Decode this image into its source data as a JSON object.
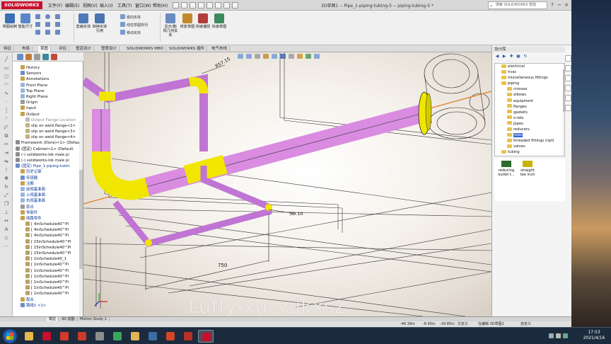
{
  "app": {
    "logo": "SOLIDWORKS",
    "title": "3D草图1 -- Pipe_1-piping-tubing-5 -- piping-tubing-5 *",
    "menu": [
      "文件(F)",
      "编辑(E)",
      "视图(V)",
      "插入(I)",
      "工具(T)",
      "窗口(W)",
      "帮助(H)"
    ],
    "search_placeholder": "搜索 SOLIDWORKS 帮助",
    "window_controls": [
      "?",
      "−",
      "□",
      "×"
    ]
  },
  "ribbon": {
    "big_buttons": [
      {
        "label": "草图绘制",
        "icon": "sketch-icon",
        "color": "#3a6fb5"
      },
      {
        "label": "智能尺寸",
        "icon": "smart-dimension-icon",
        "color": "#5a86c8"
      },
      {
        "label": "剪裁实体",
        "icon": "trim-entities-icon",
        "color": "#4f7ab8"
      },
      {
        "label": "转换实体引用",
        "icon": "convert-entities-icon",
        "color": "#4b74b0"
      },
      {
        "label": "显示/删除几何关系",
        "icon": "relations-icon",
        "color": "#6a8ac0"
      },
      {
        "label": "修复草图",
        "icon": "repair-sketch-icon",
        "color": "#c28a2a"
      },
      {
        "label": "快速捕捉",
        "icon": "quick-snaps-icon",
        "color": "#b13d3d"
      },
      {
        "label": "快速草图",
        "icon": "rapid-sketch-icon",
        "color": "#3d8a5a"
      }
    ],
    "small_buttons": [
      "镜向实体",
      "线性草图阵列",
      "移动实体"
    ]
  },
  "command_tabs": [
    "特征",
    "布局",
    "草图",
    "评估",
    "管道设计",
    "管筒设计",
    "SOLIDWORKS MBD",
    "SOLIDWORKS 插件",
    "电气布线"
  ],
  "feature_tree": [
    {
      "label": "History",
      "indent": 1,
      "color": "#c7a14a",
      "style": ""
    },
    {
      "label": "Sensors",
      "indent": 1,
      "color": "#6b8cc7",
      "style": ""
    },
    {
      "label": "Annotations",
      "indent": 1,
      "color": "#c7a14a",
      "style": ""
    },
    {
      "label": "Front Plane",
      "indent": 1,
      "color": "#9bb5dc",
      "style": ""
    },
    {
      "label": "Top Plane",
      "indent": 1,
      "color": "#9bb5dc",
      "style": ""
    },
    {
      "label": "Right Plane",
      "indent": 1,
      "color": "#9bb5dc",
      "style": ""
    },
    {
      "label": "Origin",
      "indent": 1,
      "color": "#999999",
      "style": ""
    },
    {
      "label": "Input",
      "indent": 1,
      "color": "#c7a14a",
      "style": ""
    },
    {
      "label": "Output",
      "indent": 1,
      "color": "#c7a14a",
      "style": ""
    },
    {
      "label": "Output Flange Location",
      "indent": 2,
      "color": "#bbbbbb",
      "style": "gray"
    },
    {
      "label": "slip on weld flange<2>",
      "indent": 2,
      "color": "#c2b280",
      "style": ""
    },
    {
      "label": "slip on weld flange<3>",
      "indent": 2,
      "color": "#c2b280",
      "style": ""
    },
    {
      "label": "slip on weld flange<4>",
      "indent": 2,
      "color": "#c2b280",
      "style": ""
    },
    {
      "label": "Framework (Done)<1> (Defau",
      "indent": 0,
      "color": "#8c8c8c",
      "style": ""
    },
    {
      "label": "(固定) Cabinet<1> (Default",
      "indent": 0,
      "color": "#8c8c8c",
      "style": ""
    },
    {
      "label": "(-) solidworks-lok male pi",
      "indent": 0,
      "color": "#8c8c8c",
      "style": ""
    },
    {
      "label": "(-) solidworks-lok male pi",
      "indent": 0,
      "color": "#8c8c8c",
      "style": ""
    },
    {
      "label": "(固定) Pipe_1-piping-tubin",
      "indent": 0,
      "color": "#6b8cc7",
      "style": "blue"
    },
    {
      "label": "历史记录",
      "indent": 1,
      "color": "#c7a14a",
      "style": "blue"
    },
    {
      "label": "传感器",
      "indent": 1,
      "color": "#6b8cc7",
      "style": "blue"
    },
    {
      "label": "注解",
      "indent": 1,
      "color": "#c7a14a",
      "style": "blue"
    },
    {
      "label": "前视基准面",
      "indent": 1,
      "color": "#9bb5dc",
      "style": "blue"
    },
    {
      "label": "上视基准面",
      "indent": 1,
      "color": "#9bb5dc",
      "style": "blue"
    },
    {
      "label": "右视基准面",
      "indent": 1,
      "color": "#9bb5dc",
      "style": "blue"
    },
    {
      "label": "原点",
      "indent": 1,
      "color": "#999999",
      "style": "blue"
    },
    {
      "label": "零部件",
      "indent": 1,
      "color": "#c7a14a",
      "style": "blue"
    },
    {
      "label": "线路零件",
      "indent": 1,
      "color": "#c7a14a",
      "style": "blue"
    },
    {
      "label": "[ 4inSchedule40^Pi",
      "indent": 2,
      "color": "#b7a36a",
      "style": ""
    },
    {
      "label": "[ 4inSchedule40^Pi",
      "indent": 2,
      "color": "#b7a36a",
      "style": ""
    },
    {
      "label": "[ 4inSchedule40^Pi",
      "indent": 2,
      "color": "#b7a36a",
      "style": ""
    },
    {
      "label": "[ 15inSchedule40^Pi",
      "indent": 2,
      "color": "#b7a36a",
      "style": ""
    },
    {
      "label": "[ 15inSchedule40^Pi",
      "indent": 2,
      "color": "#b7a36a",
      "style": ""
    },
    {
      "label": "[ 15inSchedule40^Pi",
      "indent": 2,
      "color": "#b7a36a",
      "style": ""
    },
    {
      "label": "[ 1inSchedule40_1",
      "indent": 2,
      "color": "#b7a36a",
      "style": ""
    },
    {
      "label": "[ 1inSchedule40^Pi",
      "indent": 2,
      "color": "#b7a36a",
      "style": ""
    },
    {
      "label": "[ 1inSchedule40^Pi",
      "indent": 2,
      "color": "#b7a36a",
      "style": ""
    },
    {
      "label": "[ 1inSchedule40^Pi",
      "indent": 2,
      "color": "#b7a36a",
      "style": ""
    },
    {
      "label": "[ 1inSchedule40^Pi",
      "indent": 2,
      "color": "#b7a36a",
      "style": ""
    },
    {
      "label": "[ 1inSchedule40^Pi",
      "indent": 2,
      "color": "#b7a36a",
      "style": ""
    },
    {
      "label": "[ 1inSchedule40^Pi",
      "indent": 2,
      "color": "#b7a36a",
      "style": ""
    },
    {
      "label": "配合",
      "indent": 1,
      "color": "#c7a14a",
      "style": "blue"
    },
    {
      "label": "路线1 <1>",
      "indent": 1,
      "color": "#6b8cc7",
      "style": "blue"
    }
  ],
  "viewport": {
    "dimensions": [
      "R57.15",
      "750",
      "3D.10"
    ],
    "watermark": "Luffy-xu:szjkxsz",
    "pipe_color": "#d98ce0",
    "fitting_color": "#f0e600"
  },
  "task_pane": {
    "header": "设计库",
    "library_tree": [
      {
        "label": "electrical",
        "indent": 1,
        "selected": false
      },
      {
        "label": "hvac",
        "indent": 1,
        "selected": false
      },
      {
        "label": "miscellaneous fittings",
        "indent": 1,
        "selected": false
      },
      {
        "label": "piping",
        "indent": 1,
        "selected": false
      },
      {
        "label": "crosses",
        "indent": 2,
        "selected": false
      },
      {
        "label": "elbows",
        "indent": 2,
        "selected": false
      },
      {
        "label": "equipment",
        "indent": 2,
        "selected": false
      },
      {
        "label": "flanges",
        "indent": 2,
        "selected": false
      },
      {
        "label": "gaskets",
        "indent": 2,
        "selected": false
      },
      {
        "label": "o-lets",
        "indent": 2,
        "selected": false
      },
      {
        "label": "pipes",
        "indent": 2,
        "selected": false
      },
      {
        "label": "reducers",
        "indent": 2,
        "selected": false
      },
      {
        "label": "tees",
        "indent": 2,
        "selected": true
      },
      {
        "label": "threaded fittings (npt)",
        "indent": 2,
        "selected": false
      },
      {
        "label": "valves",
        "indent": 2,
        "selected": false
      },
      {
        "label": "tubing",
        "indent": 1,
        "selected": false
      }
    ],
    "items": [
      {
        "label": "reducing outlet t...",
        "color": "#2c6a2c"
      },
      {
        "label": "straight tee inch",
        "color": "#c8b400"
      }
    ]
  },
  "model_tabs": [
    "模型",
    "3D 视图",
    "Motion Study 1"
  ],
  "status": {
    "x": "-46.39in",
    "y": "-8.95in",
    "z": "-18.85in",
    "state": "欠定义",
    "mode": "在编辑 3D草图1",
    "units": "自定义"
  },
  "taskbar": {
    "apps": [
      {
        "icon": "explorer-icon",
        "color": "#e8b84a"
      },
      {
        "icon": "sw-icon",
        "color": "#c8102e"
      },
      {
        "icon": "acrobat-icon",
        "color": "#d33a2a"
      },
      {
        "icon": "autocad-icon",
        "color": "#cc3b2a"
      },
      {
        "icon": "sw-edrawings-icon",
        "color": "#8e8e8e"
      },
      {
        "icon": "chrome-icon",
        "color": "#3ba55d"
      },
      {
        "icon": "folder-icon",
        "color": "#e2b453"
      },
      {
        "icon": "camera-icon",
        "color": "#3a6ea5"
      },
      {
        "icon": "powerpoint-icon",
        "color": "#d24726"
      },
      {
        "icon": "wps-icon",
        "color": "#b8302a"
      },
      {
        "icon": "solidworks-active-icon",
        "color": "#c8102e"
      }
    ],
    "time": "17:53",
    "date": "2021/4/16"
  }
}
